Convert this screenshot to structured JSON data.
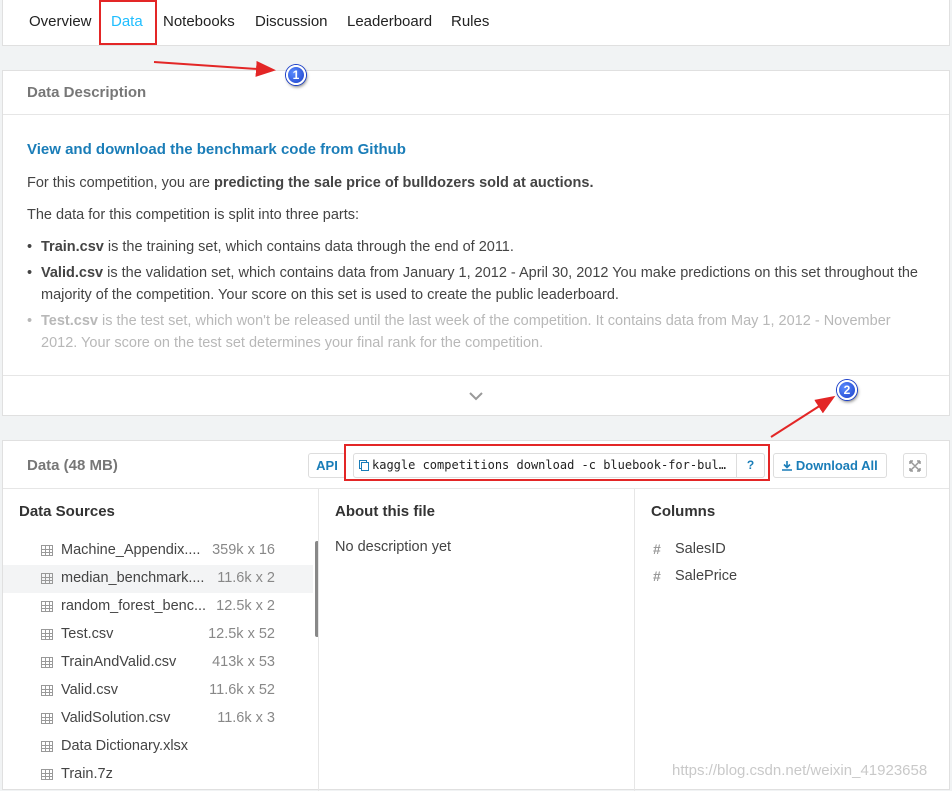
{
  "tabs": [
    "Overview",
    "Data",
    "Notebooks",
    "Discussion",
    "Leaderboard",
    "Rules"
  ],
  "annotations": {
    "badge1": "1",
    "badge2": "2",
    "color": "#e32626"
  },
  "description": {
    "header": "Data Description",
    "github_link": "View and download the benchmark code from Github",
    "intro_prefix": "For this competition, you are ",
    "intro_bold": "predicting the sale price of bulldozers sold at auctions.",
    "split_text": "The data for this competition is split into three parts:",
    "parts": [
      {
        "name": "Train.csv",
        "text": " is the training set, which contains data through the end of 2011."
      },
      {
        "name": "Valid.csv",
        "text": " is the validation set, which contains data from January 1, 2012 - April 30, 2012 You make predictions on this set throughout the majority of the competition. Your score on this set is used to create the public leaderboard."
      },
      {
        "name": "Test.csv",
        "text": " is the test set, which won't be released until the last week of the competition. It contains data from May 1, 2012 - November 2012. Your score on the test set determines your final rank for the competition."
      }
    ],
    "expand_icon": "chevron-down-icon"
  },
  "data_panel": {
    "title": "Data (48 MB)",
    "api_label": "API",
    "command": "kaggle competitions download -c bluebook-for-bul…",
    "help_label": "?",
    "download_label": "Download All",
    "sources_header": "Data Sources",
    "about_header": "About this file",
    "about_text": "No description yet",
    "columns_header": "Columns",
    "files": [
      {
        "name": "Machine_Appendix....",
        "size": "359k x 16"
      },
      {
        "name": "median_benchmark....",
        "size": "11.6k x 2"
      },
      {
        "name": "random_forest_benc...",
        "size": "12.5k x 2"
      },
      {
        "name": "Test.csv",
        "size": "12.5k x 52"
      },
      {
        "name": "TrainAndValid.csv",
        "size": "413k x 53"
      },
      {
        "name": "Valid.csv",
        "size": "11.6k x 52"
      },
      {
        "name": "ValidSolution.csv",
        "size": "11.6k x 3"
      },
      {
        "name": "Data Dictionary.xlsx",
        "size": ""
      },
      {
        "name": "Train.7z",
        "size": ""
      }
    ],
    "columns": [
      "SalesID",
      "SalePrice"
    ]
  },
  "watermark": "https://blog.csdn.net/weixin_41923658"
}
